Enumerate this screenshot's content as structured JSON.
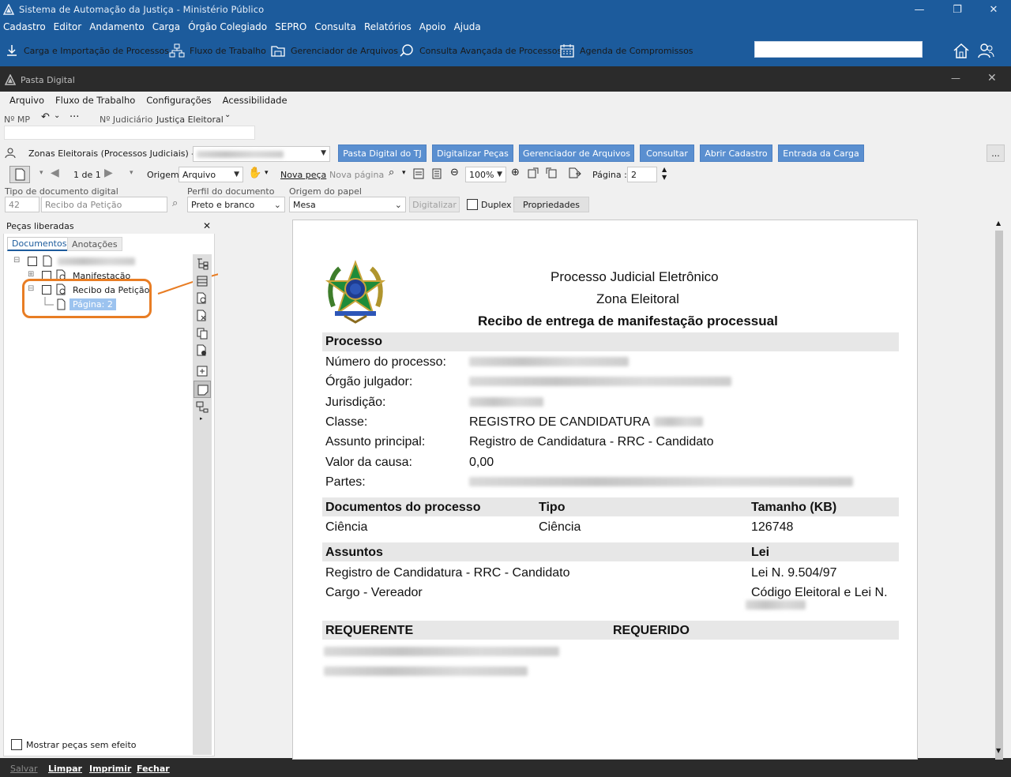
{
  "app": {
    "title": "Sistema de Automação da Justiça - Ministério Público",
    "menu": [
      "Cadastro",
      "Editor",
      "Andamento",
      "Carga",
      "Órgão Colegiado",
      "SEPRO",
      "Consulta",
      "Relatórios",
      "Apoio",
      "Ajuda"
    ],
    "toolbar": {
      "carga": "Carga e Importação de Processos",
      "fluxo": "Fluxo de Trabalho",
      "gerenciador": "Gerenciador de Arquivos",
      "consulta": "Consulta Avançada de Processos",
      "agenda": "Agenda de Compromissos"
    },
    "search_value": ""
  },
  "pasta": {
    "title": "Pasta Digital",
    "menu": [
      "Arquivo",
      "Fluxo de Trabalho",
      "Configurações",
      "Acessibilidade"
    ],
    "nmp_label": "Nº MP",
    "njud_label": "Nº Judiciário",
    "njud_value": "Justiça Eleitoral",
    "fila_label": "Zonas Eleitorais (Processos Judiciais) - Fila",
    "buttons": {
      "pasta_tj": "Pasta Digital do TJ",
      "digitalizar_pecas": "Digitalizar Peças",
      "gerenciador": "Gerenciador de Arquivos",
      "consultar": "Consultar",
      "abrir_cadastro": "Abrir Cadastro",
      "entrada_carga": "Entrada da Carga",
      "more": "..."
    },
    "viewer": {
      "page_count": "1 de 1",
      "origem_label": "Origem",
      "origem_value": "Arquivo",
      "nova_peca": "Nova peça",
      "nova_pagina": "Nova página",
      "zoom": "100%",
      "pagina_label": "Página :",
      "pagina_value": "2"
    },
    "tipo_label": "Tipo de documento digital",
    "tipo_code": "42",
    "tipo_value": "Recibo da Petição",
    "perfil_label": "Perfil do documento",
    "perfil_value": "Preto e branco",
    "origem_papel_label": "Origem do papel",
    "origem_papel_value": "Mesa",
    "digitalizar": "Digitalizar",
    "duplex": "Duplex",
    "propriedades": "Propriedades"
  },
  "left": {
    "title": "Peças liberadas",
    "tabs": [
      "Documentos",
      "Anotações"
    ],
    "tree": {
      "manifestacao": "Manifestação",
      "recibo": "Recibo da Petição",
      "pagina": "Página: 2"
    },
    "mostrar": "Mostrar peças sem efeito"
  },
  "doc": {
    "title1": "Processo Judicial Eletrônico",
    "title2": "Zona Eleitoral",
    "title3": "Recibo de entrega de manifestação processual",
    "sec_processo": "Processo",
    "rows": [
      {
        "label": "Número do processo:",
        "value": ""
      },
      {
        "label": "Órgão julgador:",
        "value": ""
      },
      {
        "label": "Jurisdição:",
        "value": ""
      },
      {
        "label": "Classe:",
        "value": "REGISTRO DE CANDIDATURA"
      },
      {
        "label": "Assunto principal:",
        "value": "Registro de Candidatura - RRC - Candidato"
      },
      {
        "label": "Valor da causa:",
        "value": "0,00"
      },
      {
        "label": "Partes:",
        "value": ""
      }
    ],
    "docs_header": {
      "c1": "Documentos do processo",
      "c2": "Tipo",
      "c3": "Tamanho (KB)"
    },
    "docs_row": {
      "c1": "Ciência",
      "c2": "Ciência",
      "c3": "126748"
    },
    "assuntos_header": {
      "c1": "Assuntos",
      "c2": "Lei"
    },
    "assuntos_rows": [
      {
        "c1": "Registro de Candidatura - RRC - Candidato",
        "c2": "Lei N. 9.504/97"
      },
      {
        "c1": "Cargo - Vereador",
        "c2": "Código Eleitoral e Lei N."
      }
    ],
    "req_header": {
      "c1": "REQUERENTE",
      "c2": "REQUERIDO"
    }
  },
  "bottom": {
    "salvar": "Salvar",
    "limpar": "Limpar",
    "imprimir": "Imprimir",
    "fechar": "Fechar"
  },
  "colors": {
    "brand_blue": "#1c5b9c",
    "button_blue": "#5a8fd0",
    "highlight_orange": "#e87d24"
  }
}
